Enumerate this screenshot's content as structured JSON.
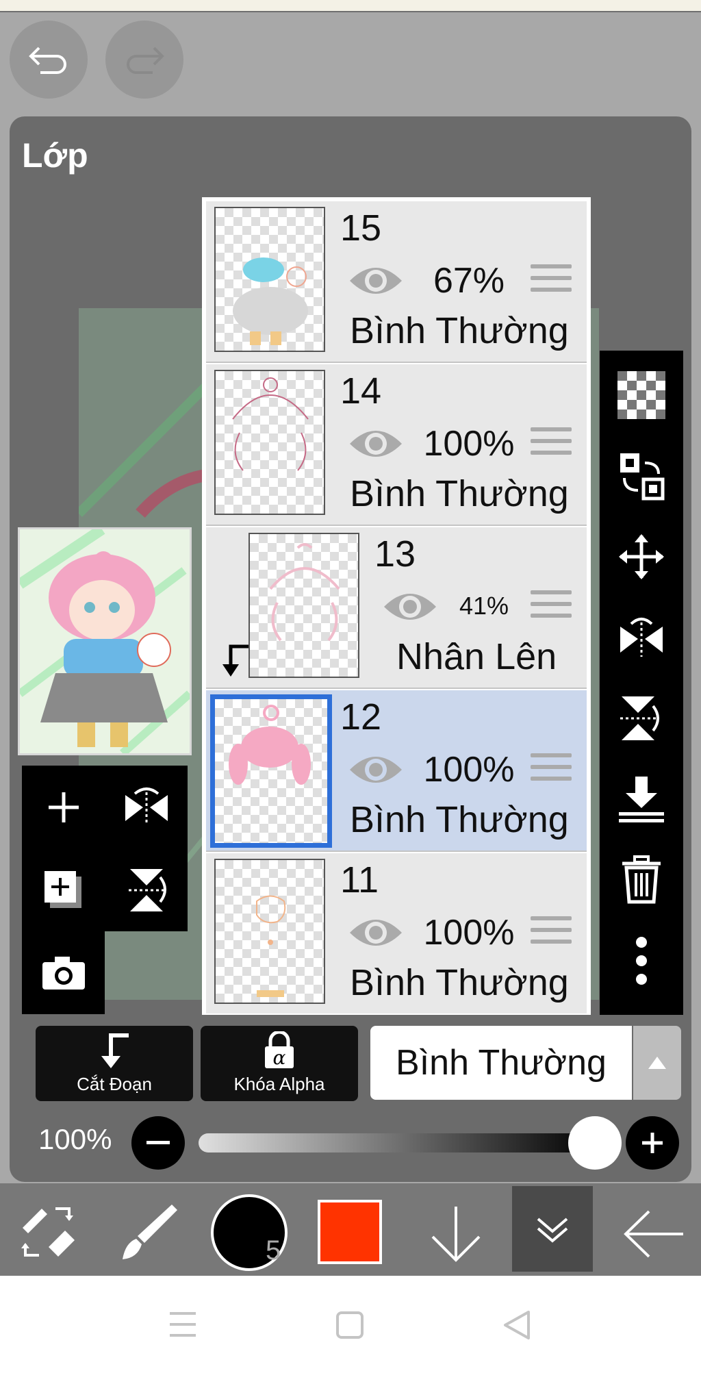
{
  "panel": {
    "title": "Lớp"
  },
  "layers": [
    {
      "number": "15",
      "opacity": "67%",
      "mode": "Bình Thường",
      "selected": false,
      "clipped": false
    },
    {
      "number": "14",
      "opacity": "100%",
      "mode": "Bình Thường",
      "selected": false,
      "clipped": false
    },
    {
      "number": "13",
      "opacity": "41%",
      "mode": "Nhân Lên",
      "selected": false,
      "clipped": true
    },
    {
      "number": "12",
      "opacity": "100%",
      "mode": "Bình Thường",
      "selected": true,
      "clipped": false
    },
    {
      "number": "11",
      "opacity": "100%",
      "mode": "Bình Thường",
      "selected": false,
      "clipped": false
    }
  ],
  "actions": {
    "clip_label": "Cắt Đoạn",
    "alpha_lock_label": "Khóa Alpha"
  },
  "blend_mode": {
    "selected": "Bình Thường"
  },
  "layer_opacity": {
    "label": "100%",
    "value": 1.0
  },
  "bottom_toolbar": {
    "brush_size": "5",
    "color": "#ff3300"
  },
  "colors": {
    "panel": "#6b6b6b",
    "selection": "#2e6fd8",
    "selected_row": "#cbd7ec"
  },
  "icons": [
    "undo-icon",
    "redo-icon",
    "add-layer-icon",
    "flip-horizontal-icon",
    "add-copy-icon",
    "flip-vertical-icon",
    "camera-icon",
    "transparency-icon",
    "select-swap-icon",
    "move-icon",
    "merge-down-icon",
    "trash-icon",
    "more-icon",
    "eye-icon"
  ]
}
